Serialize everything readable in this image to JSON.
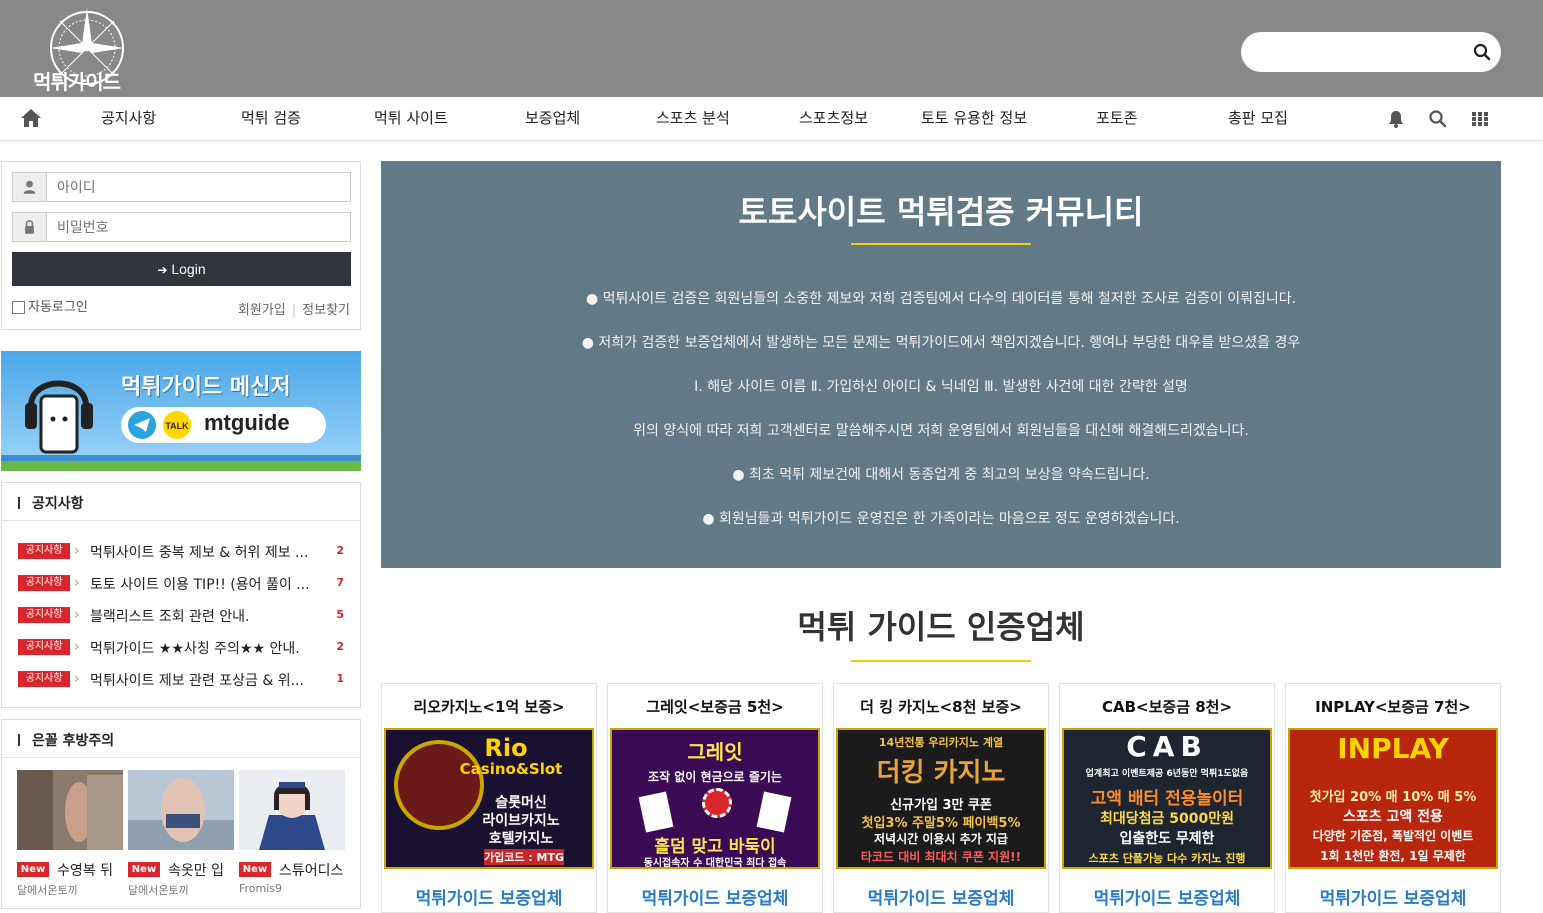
{
  "header": {
    "logo_text": "먹튀가이드",
    "search_placeholder": ""
  },
  "nav": {
    "items": [
      {
        "label": "공지사항"
      },
      {
        "label": "먹튀 검증"
      },
      {
        "label": "먹튀 사이트"
      },
      {
        "label": "보증업체"
      },
      {
        "label": "스포츠 분석"
      },
      {
        "label": "스포츠정보"
      },
      {
        "label": "토토 유용한 정보"
      },
      {
        "label": "포토존"
      },
      {
        "label": "총판 모집"
      }
    ]
  },
  "login": {
    "id_placeholder": "아이디",
    "pw_placeholder": "비밀번호",
    "button_label": "Login",
    "auto_login": "자동로그인",
    "join": "회원가입",
    "find": "정보찾기"
  },
  "banner": {
    "title": "먹튀가이드 메신저",
    "id": "mtguide"
  },
  "notice": {
    "title": "공지사항",
    "items": [
      {
        "badge": "공지사항",
        "text": "먹튀사이트 중복 제보 & 허위 제보 ...",
        "count": "2"
      },
      {
        "badge": "공지사항",
        "text": "토토 사이트 이용 TIP!! (용어 풀이 ...",
        "count": "7"
      },
      {
        "badge": "공지사항",
        "text": "블랙리스트 조회 관련 안내.",
        "count": "5"
      },
      {
        "badge": "공지사항",
        "text": "먹튀가이드 ★★사칭 주의★★ 안내.",
        "count": "2"
      },
      {
        "badge": "공지사항",
        "text": "먹튀사이트 제보 관련 포상금 & 위...",
        "count": "1"
      }
    ]
  },
  "gallery": {
    "title": "은꼴 후방주의",
    "items": [
      {
        "badge": "New",
        "title": "수영복 뒤",
        "author": "달에서온토끼"
      },
      {
        "badge": "New",
        "title": "속옷만 입",
        "author": "달에서온토끼"
      },
      {
        "badge": "New",
        "title": "스튜어디스",
        "author": "Fromis9"
      }
    ]
  },
  "hero": {
    "title": "토토사이트 먹튀검증 커뮤니티",
    "lines": [
      "● 먹튀사이트 검증은 회원님들의 소중한 제보와 저희 검증팀에서 다수의 데이터를 통해 철저한 조사로 검증이 이뤄집니다.",
      "● 저희가 검증한 보증업체에서 발생하는 모든 문제는 먹튀가이드에서 책임지겠습니다. 행여나 부당한 대우를 받으셨을 경우",
      "Ⅰ. 해당 사이트 이름 Ⅱ. 가입하신 아이디 & 닉네임 Ⅲ. 발생한 사건에 대한 간략한 설명",
      "위의 양식에 따라 저희 고객센터로 말씀해주시면 저희 운영팀에서 회원님들을 대신해 해결해드리겠습니다.",
      "● 최초 먹튀 제보건에 대해서 동종업계 중 최고의 보상을 약속드립니다.",
      "● 회원님들과 먹튀가이드 운영진은 한 가족이라는 마음으로 정도 운영하겠습니다."
    ]
  },
  "certified": {
    "title": "먹튀 가이드 인증업체",
    "cards": [
      {
        "name": "리오카지노<1억 보증>",
        "tag": "먹튀가이드 보증업체",
        "img_lines": [
          "Rio",
          "Casino&Slot",
          "슬롯머신",
          "라이브카지노",
          "호텔카지노",
          "가입코드 : MTG"
        ],
        "img_bg": "#1a1030",
        "img_fg": "#ffd400"
      },
      {
        "name": "그레잇<보증금 5천>",
        "tag": "먹튀가이드 보증업체",
        "img_lines": [
          "그레잇",
          "조작 없이 현금으로 즐기는",
          "홀덤  맞고  바둑이",
          "동시접속자 수 대한민국 최다 접속"
        ],
        "img_bg": "#3a0a55",
        "img_fg": "#ffe34a"
      },
      {
        "name": "더 킹 카지노<8천 보증>",
        "tag": "먹튀가이드 보증업체",
        "img_lines": [
          "14년전통 우리카지노 계열",
          "더킹 카지노",
          "신규가입 3만 쿠폰",
          "첫입3% 주말5% 페이백5%",
          "저녁시간 이용시 추가 지급",
          "타코드 대비 최대치 쿠폰 지원!!"
        ],
        "img_bg": "#1b1b1b",
        "img_fg": "#f4c24a"
      },
      {
        "name": "CAB<보증금 8천>",
        "tag": "먹튀가이드 보증업체",
        "img_lines": [
          "CAB",
          "업계최고 이벤트제공 6년동안 먹튀1도없음",
          "고액 배터 전용놀이터",
          "최대당첨금 5000만원",
          "입출한도 무제한",
          "스포츠 단폴가능 다수 카지노 진행"
        ],
        "img_bg": "#1c2530",
        "img_fg": "#ffffff"
      },
      {
        "name": "INPLAY<보증금 7천>",
        "tag": "먹튀가이드 보증업체",
        "img_lines": [
          "INPLAY",
          "첫가입 20% 매 10% 매 5%",
          "스포츠 고액 전용",
          "다양한 기준점, 폭발적인 이벤트",
          "1회 1천만 환전, 1일 무제한"
        ],
        "img_bg": "#b8260e",
        "img_fg": "#fff2a8"
      }
    ]
  }
}
